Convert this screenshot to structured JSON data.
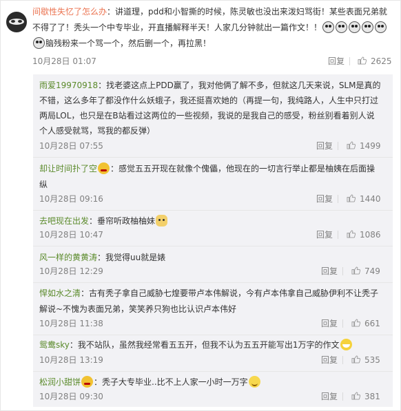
{
  "main": {
    "username": "间歇性失忆了怎么办",
    "text_parts": [
      "：讲道理，pdd和小智撕的时候，陈灵敏也没出来泼妇骂街！某些表面兄弟就",
      "不得了了！秃头一个中专毕业，开直播解释半天！人家几分钟就出一篇作文！！",
      "脑残粉来一个骂一个，然后删一个，再拉黑！"
    ],
    "time": "10月28日 01:07",
    "reply": "回复",
    "likes": "2625"
  },
  "replies": [
    {
      "name": "雨爱19970918",
      "lines": [
        "：找老婆这点上PDD赢了，我对他俩了解不多，但就这几天来说，SLM是真的",
        "不错，这么多年了都没作什么妖蛾子，我还挺喜欢她的（再提一句，我纯路人，人生中只打过",
        "两局LOL，也只是在B站看过这两位的一些视频，我说的是我自己的感受，粉丝别看着别人说",
        "个人感受就骂，骂我的都反弹）"
      ],
      "time": "10月28日 07:55",
      "reply": "回复",
      "likes": "1499"
    },
    {
      "name": "却让时间扑了空",
      "lines": [
        "：感觉五五开现在就像个傀儡，他现在的一切言行举止都是柚姨在后面操",
        "纵"
      ],
      "time": "10月28日 09:16",
      "reply": "回复",
      "likes": "1440"
    },
    {
      "name": "去吧现在出发",
      "lines": [
        "：垂帘听政柚柚妹"
      ],
      "time": "10月28日 10:47",
      "reply": "回复",
      "likes": "1086"
    },
    {
      "name": "风一样的黄黄涛",
      "lines": [
        "：我觉得uu就是婊"
      ],
      "time": "10月28日 12:29",
      "reply": "回复",
      "likes": "749"
    },
    {
      "name": "悍如水之清",
      "lines": [
        "：古有秃子拿自己威胁七煌要带卢本伟解说，今有卢本伟拿自己威胁伊利不让秃子",
        "解说~不愧为表面兄弟，笑笑养只狗也比认识卢本伟好"
      ],
      "time": "10月28日 11:38",
      "reply": "回复",
      "likes": "661"
    },
    {
      "name": "鸳鸯sky",
      "lines": [
        "：我不站队，虽然我经常看五五开，但我不认为五五开能写出1万字的作文"
      ],
      "time": "10月28日 13:19",
      "reply": "回复",
      "likes": "535"
    },
    {
      "name": "松润小甜饼",
      "lines": [
        "：秃子大专毕业..比不上人家一小时一万字"
      ],
      "time": "10月28日 09:30",
      "reply": "回复",
      "likes": "381"
    }
  ],
  "icons": {
    "emoji": "emoji-icon",
    "thumb": "thumbs-up-icon",
    "avatar": "avatar-image"
  },
  "colors": {
    "accent": "#eb7350",
    "gray": "#808080",
    "reply_bg": "#f2f2f5"
  }
}
